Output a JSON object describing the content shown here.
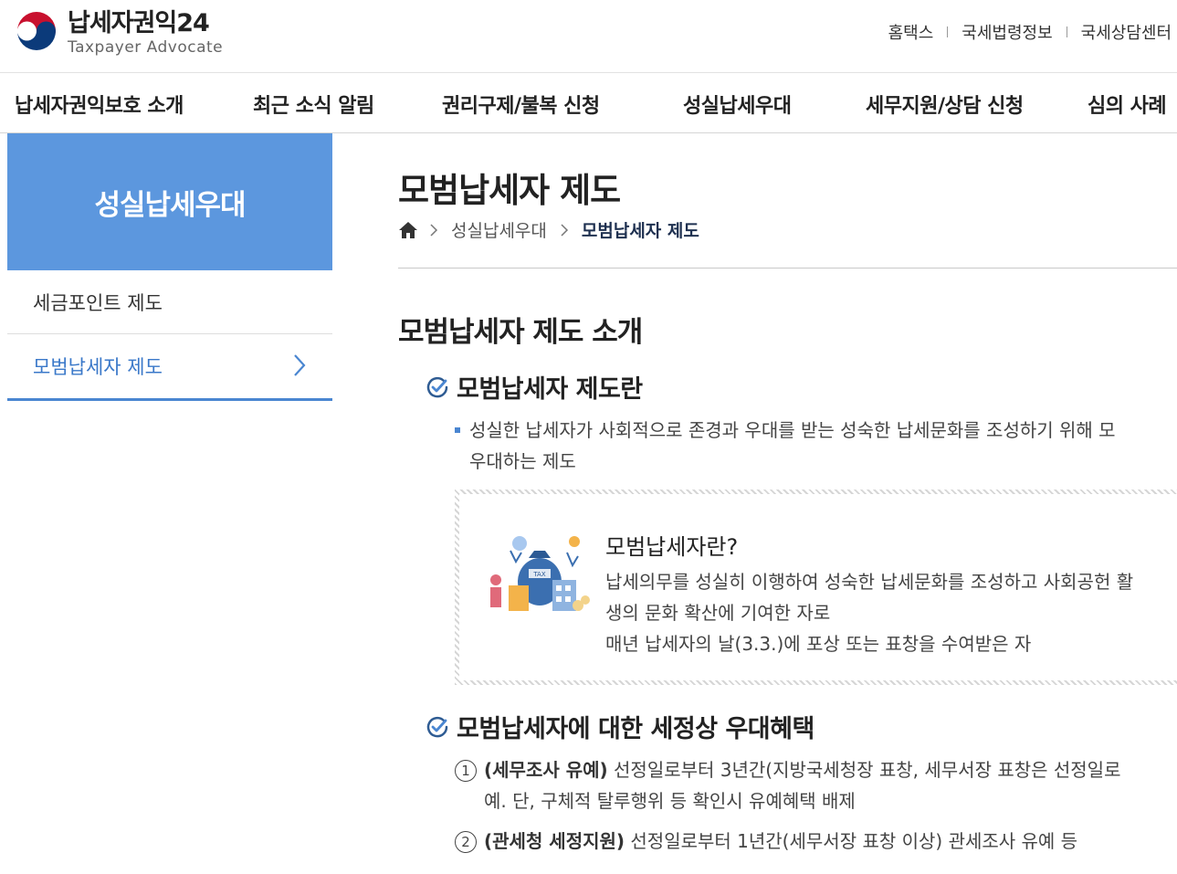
{
  "header": {
    "logo_title": "납세자권익24",
    "logo_sub": "Taxpayer Advocate",
    "util_links": [
      "홈택스",
      "국세법령정보",
      "국세상담센터"
    ]
  },
  "gnb": [
    "납세자권익보호 소개",
    "최근 소식 알림",
    "권리구제/불복 신청",
    "성실납세우대",
    "세무지원/상담 신청",
    "심의 사례"
  ],
  "sidebar": {
    "title": "성실납세우대",
    "items": [
      {
        "label": "세금포인트 제도"
      },
      {
        "label": "모범납세자 제도"
      }
    ]
  },
  "main": {
    "title": "모범납세자 제도",
    "breadcrumb": [
      "성실납세우대",
      "모범납세자 제도"
    ],
    "section_title": "모범납세자 제도 소개",
    "sub1_title": "모범납세자 제도란",
    "sub1_bullet_line1": "성실한 납세자가 사회적으로 존경과 우대를 받는 성숙한 납세문화를 조성하기 위해 모",
    "sub1_bullet_line2": "우대하는 제도",
    "box_title": "모범납세자란?",
    "box_line1": "납세의무를 성실히 이행하여 성숙한 납세문화를 조성하고 사회공헌 활",
    "box_line2": "생의 문화 확산에 기여한 자로",
    "box_line3": "매년 납세자의 날(3.3.)에 포상 또는 표창을 수여받은 자",
    "sub2_title": "모범납세자에 대한 세정상 우대혜택",
    "benefits": [
      {
        "num": "1",
        "head": "(세무조사 유예)",
        "text": " 선정일로부터 3년간(지방국세청장 표창, 세무서장 표창은 선정일로",
        "cont": "예. 단, 구체적 탈루행위 등 확인시 유예혜택 배제"
      },
      {
        "num": "2",
        "head": "(관세청 세정지원)",
        "text": " 선정일로부터 1년간(세무서장 표창 이상) 관세조사 유예 등"
      }
    ]
  },
  "colors": {
    "accent": "#5c97de",
    "active_text": "#3a78c9"
  }
}
